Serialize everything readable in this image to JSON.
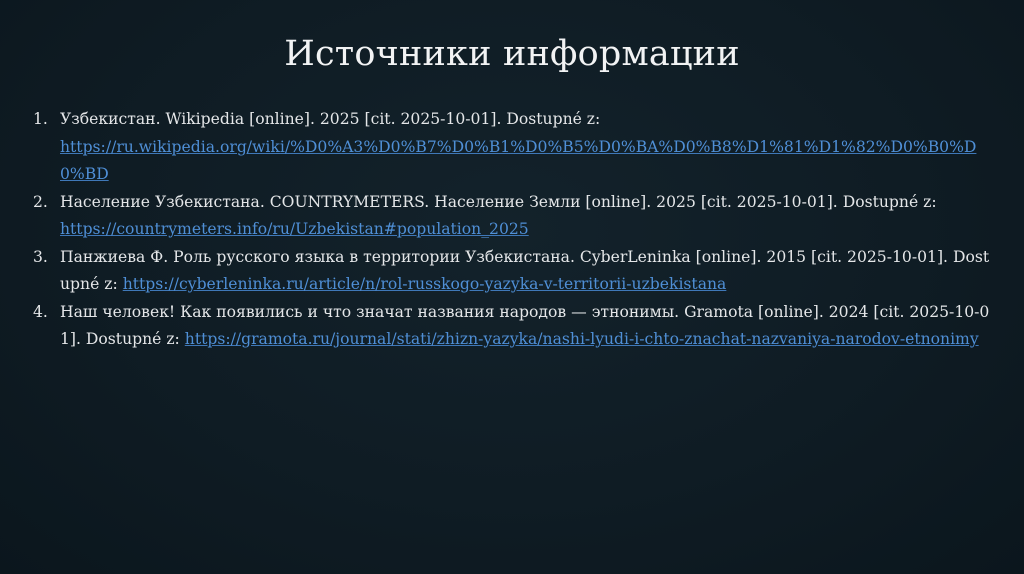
{
  "title": "Источники информации",
  "sources": [
    {
      "number": "1.",
      "text": "Узбекистан. Wikipedia [online]. 2025 [cit. 2025-10-01]. Dostupné z:",
      "url": "https://ru.wikipedia.org/wiki/%D0%A3%D0%B7%D0%B1%D0%B5%D0%BA%D0%B8%D1%81%D1%82%D0%B0%D0%BD"
    },
    {
      "number": "2.",
      "text": "Население Узбекистана. COUNTRYMETERS. Население Земли [online]. 2025 [cit. 2025-10-01]. Dostupné z:",
      "url": "https://countrymeters.info/ru/Uzbekistan#population_2025"
    },
    {
      "number": "3.",
      "text": "Панжиева Ф. Роль русского языка в территории Узбекистана. CyberLeninka [online]. 2015 [cit. 2025-10-01]. Dostupné z:",
      "url": "https://cyberleninka.ru/article/n/rol-russkogo-yazyka-v-territorii-uzbekistana"
    },
    {
      "number": "4.",
      "text": "Наш человек! Как появились и что значат названия народов — этнонимы. Gramota [online]. 2024 [cit. 2025-10-01]. Dostupné z:",
      "url": "https://gramota.ru/journal/stati/zhizn-yazyka/nashi-lyudi-i-chto-znachat-nazvaniya-narodov-etnonimy"
    }
  ]
}
